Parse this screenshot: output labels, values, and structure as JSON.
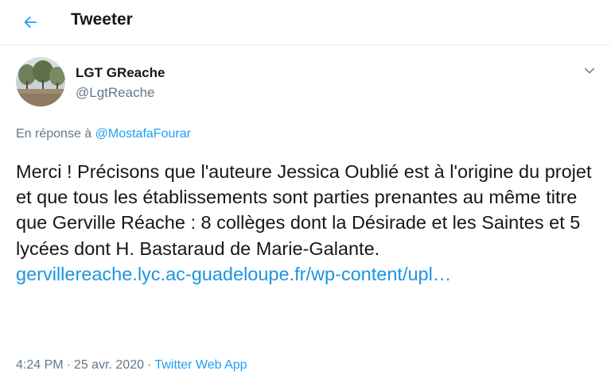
{
  "header": {
    "title": "Tweeter"
  },
  "author": {
    "name": "LGT GReache",
    "handle": "@LgtReache"
  },
  "reply": {
    "prefix": "En réponse à",
    "to": "@MostafaFourar"
  },
  "tweet": {
    "text": "Merci ! Précisons que l'auteure Jessica Oublié est à l'origine du projet et que tous les établissements sont parties prenantes au même titre que Gerville Réache : 8 collèges dont la Désirade et les Saintes et 5 lycées dont H. Bastaraud de Marie-Galante.",
    "link": "gervillereache.lyc.ac-guadeloupe.fr/wp-content/upl…"
  },
  "meta": {
    "time": "4:24 PM",
    "separator": "·",
    "date": "25 avr. 2020",
    "source": "Twitter Web App"
  },
  "colors": {
    "accent": "#1da1f2",
    "secondary_text": "#657786",
    "primary_text": "#14171a"
  },
  "icons": {
    "back": "arrow-left-icon",
    "more": "chevron-down-icon"
  }
}
